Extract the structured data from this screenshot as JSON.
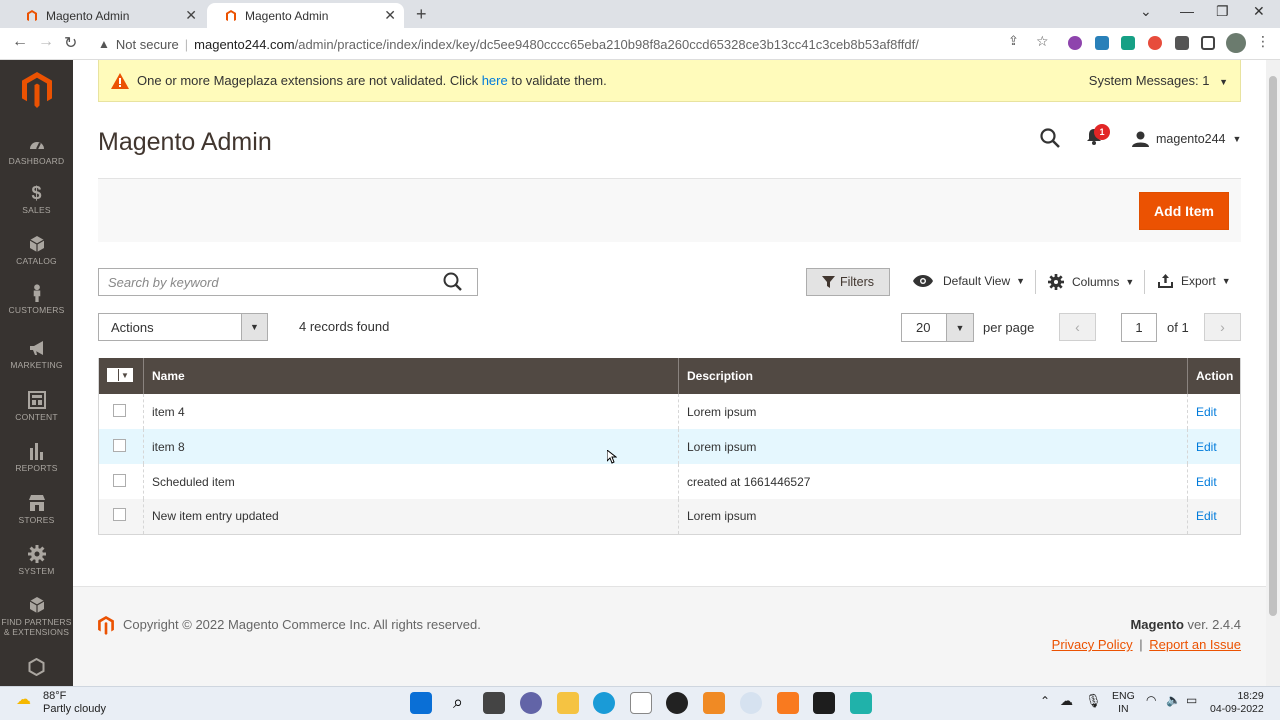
{
  "browser": {
    "tabs": [
      {
        "title": "Magento Admin"
      },
      {
        "title": "Magento Admin"
      }
    ],
    "security_label": "Not secure",
    "url_host": "magento244.com",
    "url_path": "/admin/practice/index/index/key/dc5ee9480cccc65eba210b98f8a260ccd65328ce3b13cc41c3ceb8b53af8ffdf/"
  },
  "sidebar": {
    "items": [
      {
        "label": "DASHBOARD",
        "icon": "dashboard-icon"
      },
      {
        "label": "SALES",
        "icon": "dollar-icon"
      },
      {
        "label": "CATALOG",
        "icon": "box-icon"
      },
      {
        "label": "CUSTOMERS",
        "icon": "person-icon"
      },
      {
        "label": "MARKETING",
        "icon": "megaphone-icon"
      },
      {
        "label": "CONTENT",
        "icon": "layout-icon"
      },
      {
        "label": "REPORTS",
        "icon": "bar-chart-icon"
      },
      {
        "label": "STORES",
        "icon": "store-icon"
      },
      {
        "label": "SYSTEM",
        "icon": "gear-icon"
      },
      {
        "label": "FIND PARTNERS & EXTENSIONS",
        "icon": "cube-icon"
      }
    ]
  },
  "system_message": {
    "text_before": "One or more Mageplaza extensions are not validated. Click ",
    "link": "here",
    "text_after": " to validate them.",
    "counter_label": "System Messages: 1"
  },
  "header": {
    "title": "Magento Admin",
    "notification_count": "1",
    "username": "magento244"
  },
  "actions": {
    "add_label": "Add Item"
  },
  "grid_controls": {
    "search_placeholder": "Search by keyword",
    "filters_label": "Filters",
    "view_label": "Default View",
    "columns_label": "Columns",
    "export_label": "Export",
    "mass_action_label": "Actions",
    "records_found": "4 records found",
    "per_page_value": "20",
    "per_page_label": "per page",
    "page_value": "1",
    "page_of": "of 1"
  },
  "grid": {
    "columns": [
      "Name",
      "Description",
      "Action"
    ],
    "rows": [
      {
        "name": "item 4",
        "description": "Lorem ipsum",
        "action": "Edit"
      },
      {
        "name": "item 8",
        "description": "Lorem ipsum",
        "action": "Edit"
      },
      {
        "name": "Scheduled item",
        "description": "created at 1661446527",
        "action": "Edit"
      },
      {
        "name": "New item entry updated",
        "description": "Lorem ipsum",
        "action": "Edit"
      }
    ]
  },
  "footer": {
    "copyright": "Copyright © 2022 Magento Commerce Inc. All rights reserved.",
    "brand": "Magento",
    "version": " ver. 2.4.4",
    "privacy": "Privacy Policy",
    "separator": "|",
    "report": "Report an Issue"
  },
  "taskbar": {
    "temp": "88°F",
    "weather": "Partly cloudy",
    "lang1": "ENG",
    "lang2": "IN",
    "time": "18:29",
    "date": "04-09-2022"
  },
  "colors": {
    "accent": "#eb5202",
    "sidebar": "#373330",
    "grid_header": "#514943",
    "link": "#007bdb"
  }
}
